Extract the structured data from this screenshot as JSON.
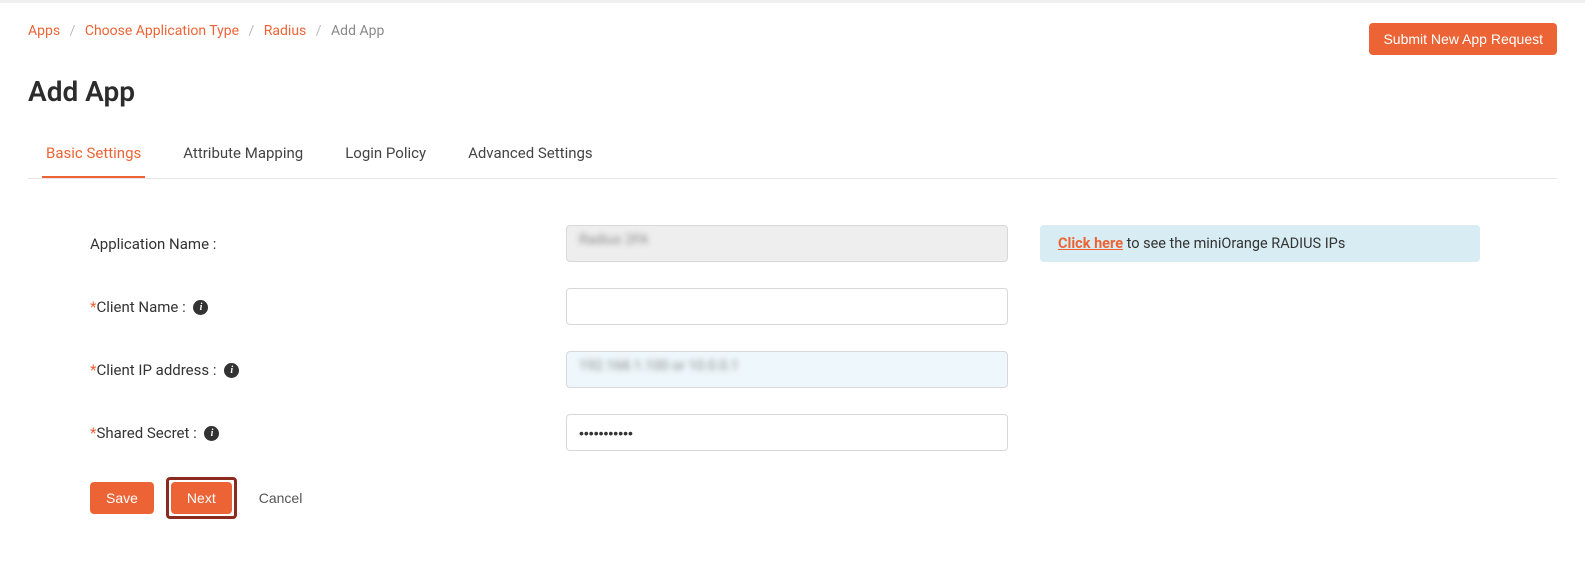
{
  "breadcrumb": {
    "items": [
      {
        "label": "Apps"
      },
      {
        "label": "Choose Application Type"
      },
      {
        "label": "Radius"
      }
    ],
    "current": "Add App"
  },
  "header": {
    "submit_button": "Submit New App Request"
  },
  "page": {
    "title": "Add App"
  },
  "tabs": {
    "basic": "Basic Settings",
    "attribute": "Attribute Mapping",
    "login": "Login Policy",
    "advanced": "Advanced Settings"
  },
  "form": {
    "app_name_label": "Application Name :",
    "app_name_value": "Radius   2FA",
    "client_name_label": "Client Name :",
    "client_name_value": "",
    "client_ip_label": "Client IP address :",
    "client_ip_value": "192.168.1.100  or  10.0.0.1",
    "shared_secret_label": "Shared Secret :",
    "shared_secret_value": "•••••••••••"
  },
  "infobox": {
    "link": "Click here",
    "text": " to see the miniOrange RADIUS IPs"
  },
  "buttons": {
    "save": "Save",
    "next": "Next",
    "cancel": "Cancel"
  }
}
